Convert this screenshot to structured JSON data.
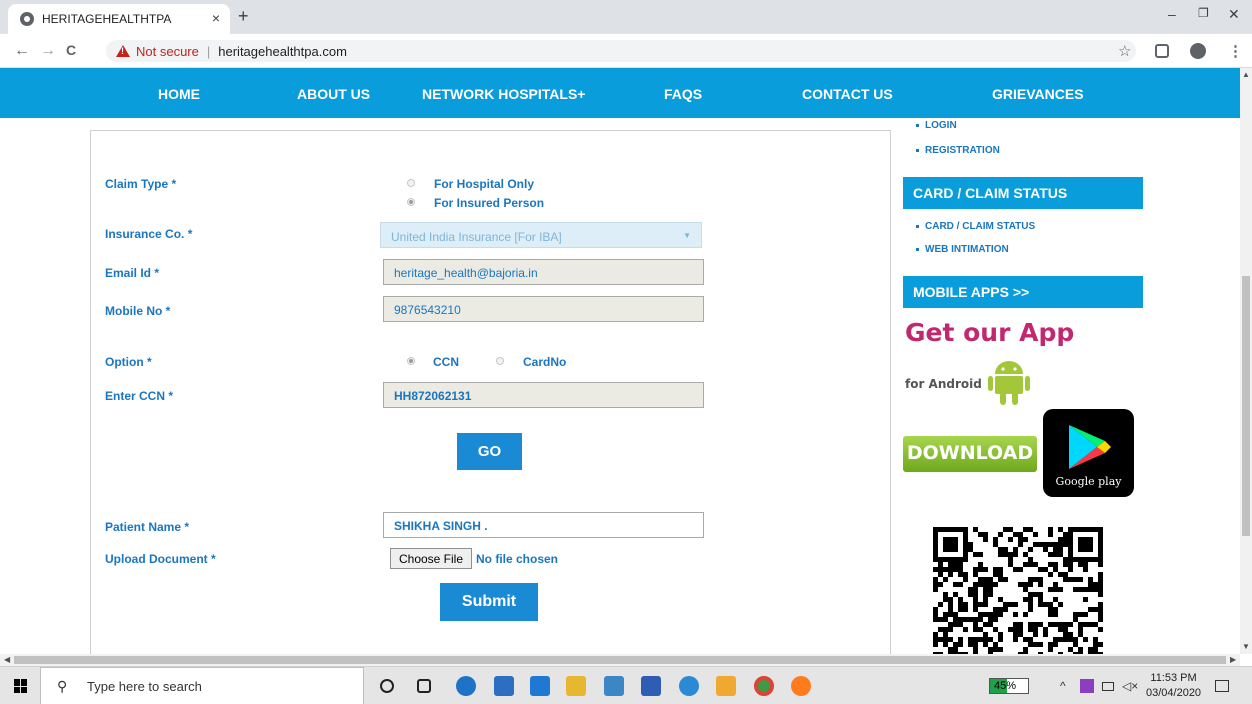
{
  "browser": {
    "tab_title": "HERITAGEHEALTHTPA",
    "tab_close": "×",
    "new_tab": "+",
    "not_secure": "Not secure",
    "separator": "|",
    "url": "heritagehealthtpa.com",
    "minimize": "–",
    "restore": "❐",
    "close": "✕",
    "back": "←",
    "forward": "→",
    "reload": "C",
    "star": "☆",
    "menu": "⋮"
  },
  "nav": {
    "items": [
      "HOME",
      "ABOUT US",
      "NETWORK HOSPITALS+",
      "FAQS",
      "CONTACT US",
      "GRIEVANCES"
    ]
  },
  "form": {
    "claim_type_label": "Claim Type *",
    "claim_type_options": [
      {
        "label": "For Hospital Only",
        "checked": false
      },
      {
        "label": "For Insured Person",
        "checked": true
      }
    ],
    "insurance_label": "Insurance Co. *",
    "insurance_value": "United India Insurance [For IBA]",
    "email_label": "Email Id *",
    "email_value": "heritage_health@bajoria.in",
    "mobile_label": "Mobile No *",
    "mobile_value": "9876543210",
    "option_label": "Option *",
    "option_choices": [
      {
        "label": "CCN",
        "checked": true
      },
      {
        "label": "CardNo",
        "checked": false
      }
    ],
    "ccn_label": "Enter CCN *",
    "ccn_value": "HH872062131",
    "go_label": "GO",
    "patient_label": "Patient Name *",
    "patient_value": "SHIKHA SINGH .",
    "upload_label": "Upload Document *",
    "choose_file": "Choose File",
    "no_file": "No file chosen",
    "submit_label": "Submit"
  },
  "sidebar": {
    "links_top": [
      "LOGIN",
      "REGISTRATION"
    ],
    "card_heading": "CARD / CLAIM STATUS",
    "card_links": [
      "CARD / CLAIM STATUS",
      "WEB INTIMATION"
    ],
    "apps_heading": "MOBILE APPS >>",
    "app_title": "Get our App",
    "app_sub": "for Android",
    "download": "DOWNLOAD",
    "google_play": "Google play"
  },
  "taskbar": {
    "search_placeholder": "Type here to search",
    "battery": "45%",
    "battery_level": 0.45,
    "time": "11:53 PM",
    "date": "03/04/2020"
  }
}
